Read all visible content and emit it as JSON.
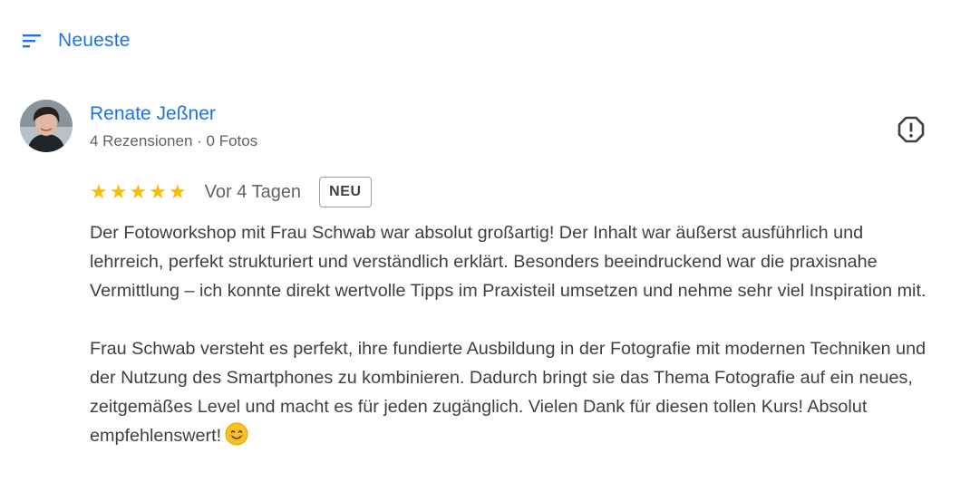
{
  "sort": {
    "icon": "sort-icon",
    "label": "Neueste"
  },
  "review": {
    "author": {
      "name": "Renate Jeßner",
      "meta": "4 Rezensionen · 0 Fotos",
      "avatar_icon": "profile-photo"
    },
    "rating": 5,
    "stars": [
      "★",
      "★",
      "★",
      "★",
      "★"
    ],
    "date": "Vor 4 Tagen",
    "badge": "NEU",
    "report_icon": "report-icon",
    "paragraphs": [
      "Der Fotoworkshop mit Frau Schwab war absolut großartig! Der Inhalt war äußerst ausführlich und lehrreich, perfekt strukturiert und verständlich erklärt. Besonders beeindruckend war die praxisnahe Vermittlung – ich konnte direkt wertvolle Tipps im Praxisteil umsetzen und nehme sehr viel Inspiration mit.",
      "Frau Schwab versteht es perfekt, ihre fundierte Ausbildung in der Fotografie mit modernen Techniken und der Nutzung des Smartphones zu kombinieren. Dadurch bringt sie das Thema Fotografie auf ein neues, zeitgemäßes Level und macht es für jeden zugänglich. Vielen Dank für diesen tollen Kurs! Absolut empfehlenswert!"
    ],
    "emoji": "smiling-face-emoji"
  },
  "colors": {
    "link": "#1a73e8",
    "text": "#3c4043",
    "secondary": "#5f6368",
    "star": "#fbbc04"
  }
}
